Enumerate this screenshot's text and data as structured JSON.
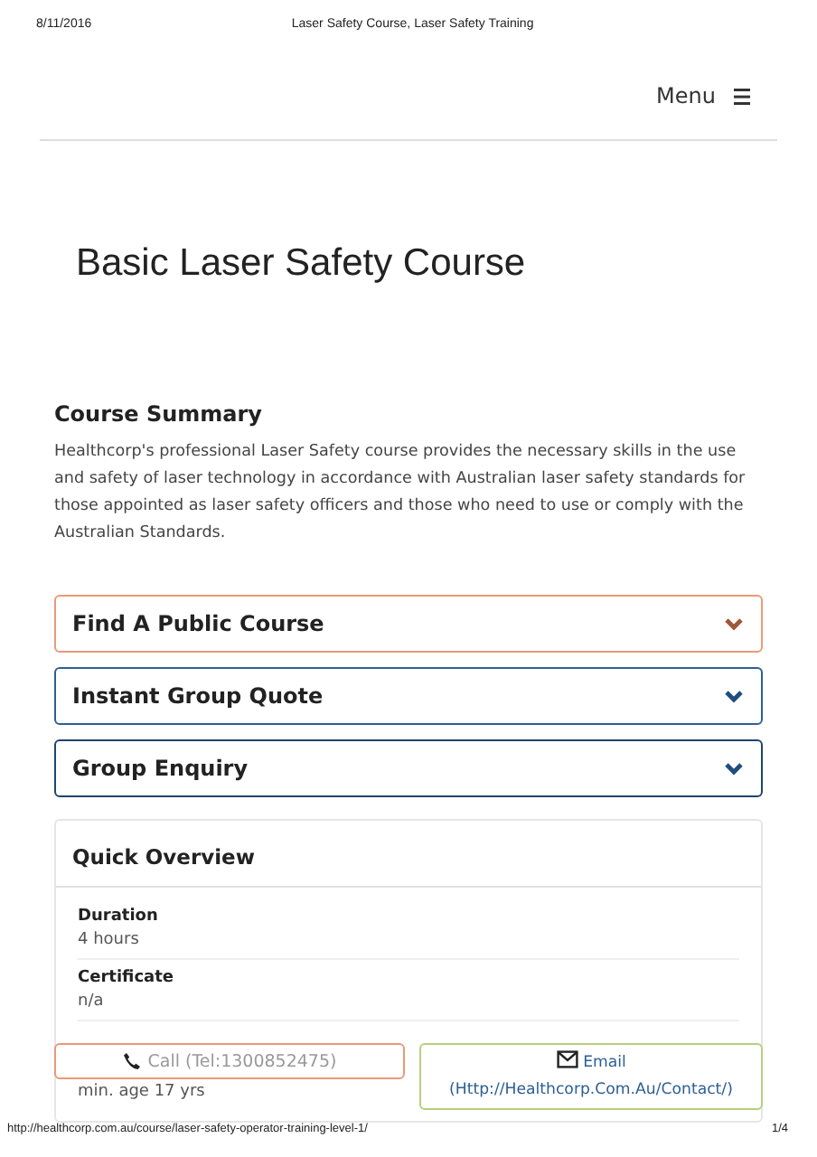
{
  "print_header": {
    "date": "8/11/2016",
    "title": "Laser Safety Course, Laser Safety Training"
  },
  "nav": {
    "menu_label": "Menu"
  },
  "page_title": "Basic Laser Safety Course",
  "summary": {
    "heading": "Course Summary",
    "text": "Healthcorp's professional Laser Safety course provides the necessary skills in the use and safety of laser technology in accordance with Australian laser safety standards for those appointed as laser safety officers and those who need to use or comply with the Australian Standards."
  },
  "accordions": [
    {
      "label": "Find A Public Course",
      "color": "#e89a78",
      "expanded": false
    },
    {
      "label": "Instant Group Quote",
      "color": "#2d5f94",
      "expanded": false
    },
    {
      "label": "Group Enquiry",
      "color": "#1e456e",
      "expanded": false
    }
  ],
  "overview": {
    "heading": "Quick Overview",
    "fields": [
      {
        "label": "Duration",
        "value": "4 hours"
      },
      {
        "label": "Certificate",
        "value": "n/a"
      },
      {
        "value": "min. age 17 yrs"
      }
    ]
  },
  "contact_buttons": [
    {
      "kind": "call",
      "label": "Call (Tel:1300852475)"
    },
    {
      "kind": "email",
      "label": "Email (Http://Healthcorp.Com.Au/Contact/)"
    }
  ],
  "print_footer": {
    "url": "http://healthcorp.com.au/course/laser-safety-operator-training-level-1/",
    "page": "1/4"
  }
}
